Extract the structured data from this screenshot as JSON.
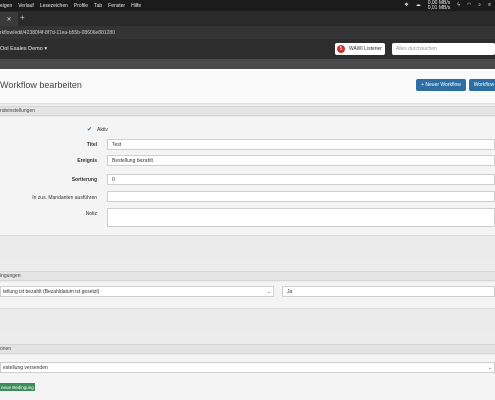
{
  "menubar": {
    "items": [
      "eigen",
      "Verlauf",
      "Lesezeichen",
      "Profile",
      "Tab",
      "Fenster",
      "Hilfe"
    ],
    "net_up": "0,00 MB/s",
    "net_down": "0,01 MB/s"
  },
  "tabbar": {
    "tab_close": "✕",
    "add": "+"
  },
  "urlbar": {
    "url": "rkflow/edit/42380f4f-8f7d-11ea-b55b-08606e881280"
  },
  "app": {
    "store_name": "Ool Esales Demo ▾",
    "wawi_badge": "5",
    "wawi_label": "WAWI Listener",
    "search_placeholder": "Alles durchsuchen"
  },
  "page": {
    "title": "Workflow bearbeiten",
    "new_workflow_button": "+ Neuer Workflow",
    "workflow_button": "Workflow"
  },
  "grundeinstellungen": {
    "header": "ndeinstellungen",
    "aktiv_label": "Aktiv",
    "aktiv_check": "✔",
    "titel_label": "Titel",
    "titel_value": "Test",
    "ereignis_label": "Ereignis",
    "ereignis_value": "Bestellung bezahlt",
    "sortierung_label": "Sortierung",
    "sortierung_value": "0",
    "mandanten_label": "In zus. Mandanten ausführen",
    "notiz_label": "Notiz"
  },
  "bedingungen": {
    "header": "ingungen",
    "condition_value": "tellung ist bezahlt (Bezahldatum ist gesetzt)",
    "condition_answer": "Ja"
  },
  "aktionen": {
    "header": "onen",
    "action_value": "estellung versenden",
    "add_condition_button": "neue Bedingung"
  }
}
